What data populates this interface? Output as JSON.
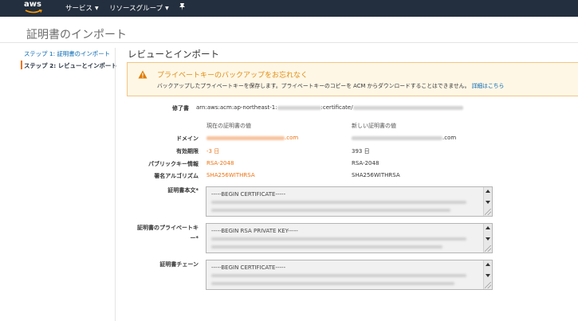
{
  "nav": {
    "logo": "aws",
    "services": "サービス",
    "resource_groups": "リソースグループ"
  },
  "page_title": "証明書のインポート",
  "steps": {
    "step1": "ステップ 1: 証明書のインポート",
    "step2": "ステップ 2: レビューとインポート"
  },
  "section_title": "レビューとインポート",
  "alert": {
    "title": "プライベートキーのバックアップをお忘れなく",
    "body": "バックアップしたプライベートキーを保存します。プライベートキーのコピーを ACM からダウンロードすることはできません。",
    "link": "詳細はこちら"
  },
  "review": {
    "modify_label": "修了書",
    "arn_prefix": "arn:aws:acm:ap-northeast-1:",
    "arn_mid": ":certificate/",
    "current_header": "現在の証明書の値",
    "new_header": "新しい証明書の値",
    "domain_label": "ドメイン",
    "domain_current_suffix": ".com",
    "domain_new_suffix": ".com",
    "expiry_label": "有効期限",
    "expiry_current": "-3 日",
    "expiry_new": "393 日",
    "pubkey_label": "パブリックキー情報",
    "pubkey_current": "RSA-2048",
    "pubkey_new": "RSA-2048",
    "sigalg_label": "署名アルゴリズム",
    "sigalg_current": "SHA256WITHRSA",
    "sigalg_new": "SHA256WITHRSA"
  },
  "fields": {
    "cert_body_label": "証明書本文*",
    "cert_body_value": "-----BEGIN CERTIFICATE-----",
    "private_key_label_1": "証明書のプライベートキ",
    "private_key_label_2": "ー*",
    "private_key_value": "-----BEGIN RSA PRIVATE KEY-----",
    "chain_label": "証明書チェーン",
    "chain_value": "-----BEGIN CERTIFICATE-----"
  },
  "colors": {
    "nav_bg": "#232f3e",
    "accent_orange": "#ec7211",
    "link_blue": "#0066b1",
    "alert_bg": "#fff7e6"
  }
}
